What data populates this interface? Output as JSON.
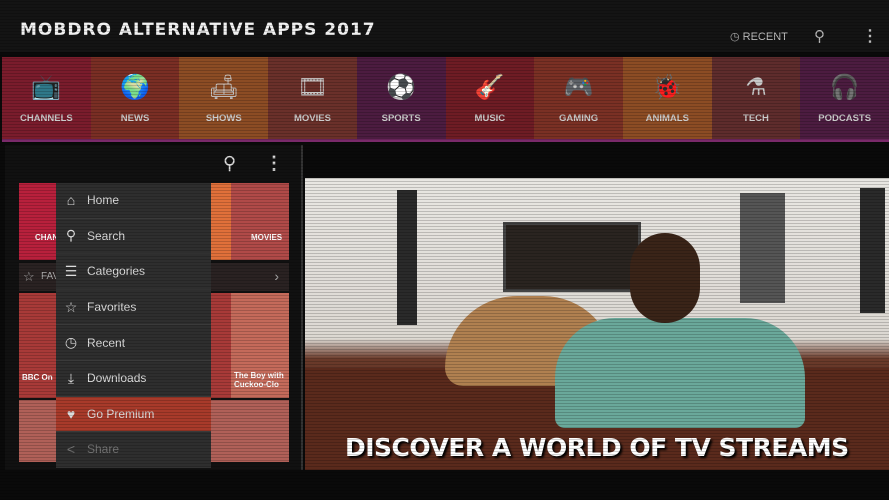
{
  "header": {
    "title": "MOBDRO ALTERNATIVE APPS 2017",
    "recent_label": "RECENT",
    "search_icon": "search-icon",
    "more_icon": "more-vert-icon"
  },
  "categories": [
    {
      "label": "CHANNELS",
      "icon": "📺",
      "color": "#7a1c2c"
    },
    {
      "label": "NEWS",
      "icon": "🌍",
      "color": "#7a2e24"
    },
    {
      "label": "SHOWS",
      "icon": "🛋",
      "color": "#8c4c24"
    },
    {
      "label": "MOVIES",
      "icon": "🎞",
      "color": "#6a302a"
    },
    {
      "label": "SPORTS",
      "icon": "⚽",
      "color": "#4c1c40"
    },
    {
      "label": "MUSIC",
      "icon": "🎸",
      "color": "#6e1c24"
    },
    {
      "label": "GAMING",
      "icon": "🎮",
      "color": "#7a3024"
    },
    {
      "label": "ANIMALS",
      "icon": "🐞",
      "color": "#8c4c24"
    },
    {
      "label": "TECH",
      "icon": "⚗",
      "color": "#5e2c2c"
    },
    {
      "label": "PODCASTS",
      "icon": "🎧",
      "color": "#4c1c40"
    }
  ],
  "phone": {
    "tiles": {
      "channels": "CHAN",
      "movies": "MOVIES",
      "favorites": "FAV",
      "bbc": "BBC On",
      "boy": "The Boy with Cuckoo-Clo"
    },
    "menu": [
      {
        "label": "Home",
        "icon": "⌂"
      },
      {
        "label": "Search",
        "icon": "⚲"
      },
      {
        "label": "Categories",
        "icon": "☰"
      },
      {
        "label": "Favorites",
        "icon": "☆"
      },
      {
        "label": "Recent",
        "icon": "◷"
      },
      {
        "label": "Downloads",
        "icon": "⤓"
      },
      {
        "label": "Go Premium",
        "icon": "♥"
      },
      {
        "label": "Share",
        "icon": "<"
      }
    ]
  },
  "banner": {
    "tagline": "DISCOVER A WORLD OF TV STREAMS"
  }
}
